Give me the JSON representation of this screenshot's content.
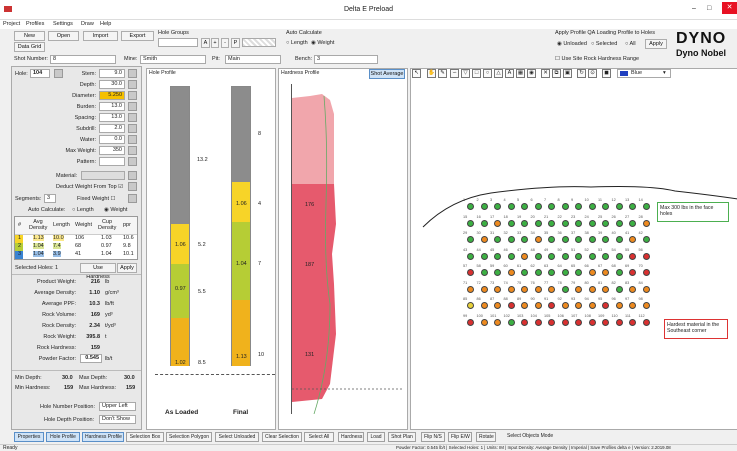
{
  "window": {
    "title": "Delta E Preload",
    "controls": [
      "–",
      "□",
      "✕"
    ]
  },
  "menu": [
    "Project",
    "Profiles",
    "Settings",
    "Draw",
    "Help"
  ],
  "toolbar": {
    "new": "New",
    "open": "Open",
    "import": "Import",
    "export": "Export",
    "data_grid": "Data Grid"
  },
  "shot_number": {
    "label": "Shot Number:",
    "value": "8"
  },
  "hole_groups": {
    "label": "Hole Groups",
    "value": ""
  },
  "mine": {
    "label": "Mine:",
    "value": "Smith"
  },
  "pit": {
    "label": "Pit:",
    "value": "Main"
  },
  "auto_calc": {
    "label": "Auto Calculate",
    "opt_length": "Length",
    "opt_weight": "Weight"
  },
  "bench": {
    "label": "Bench:",
    "value": "3"
  },
  "apply_profile": {
    "label": "Apply Profile QA Loading Profile to Holes",
    "unloaded": "Unloaded",
    "selected": "Selected",
    "all": "All",
    "apply": "Apply",
    "site_rock": "Use Site Rock Hardness Range"
  },
  "logo": {
    "line1": "DYNO",
    "line2": "Dyno Nobel"
  },
  "hole_form": {
    "hole_label": "Hole:",
    "hole_value": "104",
    "fields": [
      {
        "label": "Stem:",
        "value": "9.0"
      },
      {
        "label": "Depth:",
        "value": "30.0"
      },
      {
        "label": "Diameter:",
        "value": "5.250"
      },
      {
        "label": "Burden:",
        "value": "13.0"
      },
      {
        "label": "Spacing:",
        "value": "13.0"
      },
      {
        "label": "Subdrill:",
        "value": "2.0"
      },
      {
        "label": "Water:",
        "value": "0.0"
      },
      {
        "label": "Max Weight:",
        "value": "350"
      },
      {
        "label": "Pattern:",
        "value": ""
      }
    ],
    "material_label": "Material:",
    "deduct": "Deduct Weight From Top",
    "segments_label": "Segments:",
    "segments_value": "3",
    "fixed_weight": "Fixed Weight",
    "auto_calc_label": "Auto Calculate:",
    "opt_length": "Length",
    "opt_weight": "Weight"
  },
  "segments_table": {
    "headers": [
      "#",
      "Avg Density",
      "Length",
      "Weight",
      "Cup Density",
      "ppr"
    ],
    "rows": [
      [
        "1",
        "1.13",
        "10.0",
        "106",
        "1.03",
        "10.6"
      ],
      [
        "2",
        "1.04",
        "7.4",
        "68",
        "0.97",
        "9.8"
      ],
      [
        "3",
        "1.04",
        "3.9",
        "41",
        "1.04",
        "10.1"
      ]
    ]
  },
  "selected_holes": {
    "label": "Selected Holes: 1",
    "use_hardness": "Use Hardness",
    "apply": "Apply"
  },
  "stats": [
    {
      "label": "Product Weight:",
      "value": "216",
      "unit": "lb"
    },
    {
      "label": "Average Density:",
      "value": "1.10",
      "unit": "g/cm³"
    },
    {
      "label": "Average PPF:",
      "value": "10.3",
      "unit": "lb/ft"
    },
    {
      "label": "Rock Volume:",
      "value": "169",
      "unit": "yd³"
    },
    {
      "label": "Rock Density:",
      "value": "2.34",
      "unit": "t/yd³"
    },
    {
      "label": "Rock Weight:",
      "value": "395.8",
      "unit": "t"
    },
    {
      "label": "Rock Hardness:",
      "value": "159",
      "unit": ""
    },
    {
      "label": "Powder Factor:",
      "value": "0.545",
      "unit": "lb/t"
    }
  ],
  "depth_stats": {
    "min_depth_l": "Min Depth:",
    "min_depth_v": "30.0",
    "max_depth_l": "Max Depth:",
    "max_depth_v": "30.0",
    "min_hard_l": "Min Hardness:",
    "min_hard_v": "159",
    "max_hard_l": "Max Hardness:",
    "max_hard_v": "159"
  },
  "hole_number_position": {
    "label": "Hole Number Position:",
    "value": "Upper Left"
  },
  "hole_depth_position": {
    "label": "Hole Depth Position:",
    "value": "Don't Show"
  },
  "hole_profile": {
    "title": "Hole Profile",
    "as_loaded": "As Loaded",
    "final": "Final",
    "loaded_labels": [
      "1.06",
      "0.97",
      "1.02"
    ],
    "final_labels": [
      "1.06",
      "1.04",
      "1.13"
    ],
    "depth_marks": [
      "13.2",
      "5.2",
      "5.5",
      "8.5"
    ],
    "final_marks": [
      "8",
      "4",
      "7",
      "10"
    ]
  },
  "hardness_profile": {
    "title": "Hardness Profile",
    "shot_average": "Shot Average",
    "zone_labels": [
      "176",
      "187",
      "131"
    ]
  },
  "plan": {
    "color_value": "Blue",
    "annotation1": "Max 300 lbs in the face holes",
    "annotation2": "Hardest material in the Southeast corner",
    "colors": {
      "G": "#3cb043",
      "O": "#ee8a1f",
      "R": "#d93030",
      "Y": "#e8d13a"
    },
    "rows": [
      {
        "labels": [
          "1",
          "2",
          "3",
          "4",
          "5",
          "6",
          "7",
          "8",
          "9",
          "10",
          "11",
          "12",
          "13",
          "14"
        ],
        "colors": "GGGGGGGGGGGGGG"
      },
      {
        "labels": [
          "15",
          "16",
          "17",
          "18",
          "19",
          "20",
          "21",
          "22",
          "23",
          "24",
          "25",
          "26",
          "27",
          "28"
        ],
        "colors": "GGOGGGGGGGGGGO"
      },
      {
        "labels": [
          "29",
          "30",
          "31",
          "32",
          "33",
          "34",
          "35",
          "36",
          "37",
          "38",
          "39",
          "40",
          "41",
          "42"
        ],
        "colors": "GOGGGOGGGGGGOG"
      },
      {
        "labels": [
          "43",
          "44",
          "45",
          "46",
          "47",
          "48",
          "49",
          "50",
          "51",
          "52",
          "53",
          "54",
          "55",
          "56"
        ],
        "colors": "GGGGOGGGGGGGRR"
      },
      {
        "labels": [
          "57",
          "58",
          "59",
          "60",
          "61",
          "62",
          "63",
          "64",
          "65",
          "66",
          "67",
          "68",
          "69",
          "70"
        ],
        "colors": "RGGOGGGGGOOGRR"
      },
      {
        "labels": [
          "71",
          "72",
          "73",
          "74",
          "75",
          "76",
          "77",
          "78",
          "79",
          "80",
          "81",
          "82",
          "83",
          "84"
        ],
        "colors": "OOOOOOOGOOOGOO"
      },
      {
        "labels": [
          "85",
          "86",
          "87",
          "88",
          "89",
          "90",
          "91",
          "92",
          "93",
          "94",
          "95",
          "96",
          "97",
          "98"
        ],
        "colors": "YOOROOROOOROOO"
      },
      {
        "labels": [
          "99",
          "100",
          "101",
          "102",
          "103",
          "104",
          "105",
          "106",
          "107",
          "108",
          "109",
          "110",
          "111",
          "112"
        ],
        "colors": "ROOGRRRRRRRRRR"
      }
    ]
  },
  "bottom_tabs": [
    "Properties",
    "Hole Profile",
    "Hardness Profile",
    "Selection Box",
    "Selection Polygon",
    "Select Unloaded",
    "Clear Selection",
    "Select All",
    "Hardness",
    "Load",
    "Shot Plan",
    "Flip N/S",
    "Flip E/W",
    "Rotate",
    "Select Objects Mode"
  ],
  "status": {
    "left": "Ready",
    "right": "Powder Factor: 0.545 lb/t | Selected Holes: 1 | Units: IM | Input Density: Average Density | Imperial | Save Profiles delta e | Version: 2.2019.08"
  }
}
